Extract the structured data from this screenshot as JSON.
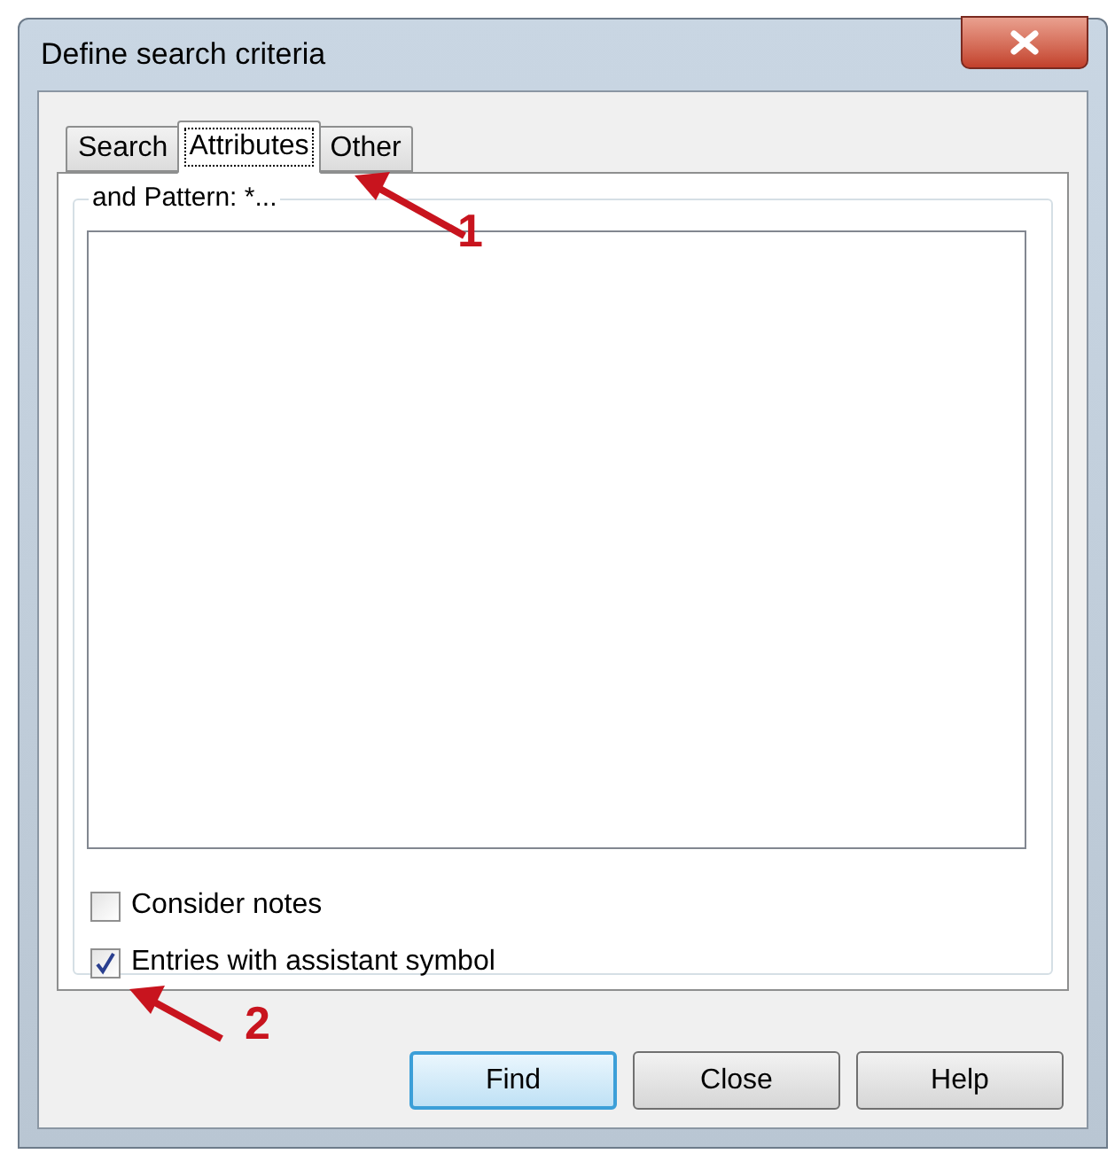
{
  "window": {
    "title": "Define search criteria"
  },
  "tabs": [
    {
      "label": "Search",
      "selected": false
    },
    {
      "label": "Attributes",
      "selected": true
    },
    {
      "label": "Other",
      "selected": false
    }
  ],
  "group": {
    "legend": "and Pattern: *..."
  },
  "checkboxes": [
    {
      "label": "Consider notes",
      "checked": false
    },
    {
      "label": "Entries with assistant symbol",
      "checked": true
    }
  ],
  "buttons": [
    {
      "label": "Find",
      "default": true
    },
    {
      "label": "Close",
      "default": false
    },
    {
      "label": "Help",
      "default": false
    }
  ],
  "annotations": [
    {
      "label": "1"
    },
    {
      "label": "2"
    }
  ]
}
